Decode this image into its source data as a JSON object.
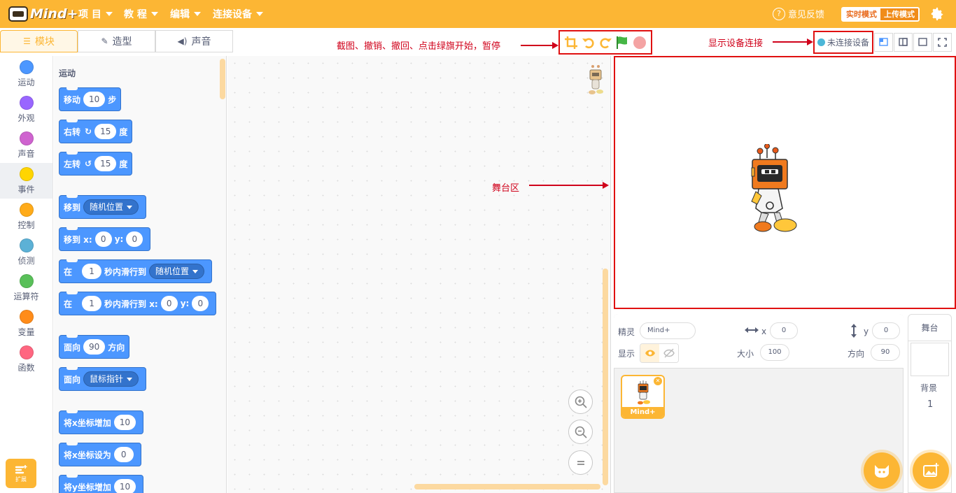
{
  "app": {
    "logo_text": "Mind+",
    "menu": [
      {
        "label": "项 目"
      },
      {
        "label": "教 程"
      },
      {
        "label": "编辑"
      },
      {
        "label": "连接设备"
      }
    ],
    "feedback": "意见反馈",
    "mode_realtime": "实时模式",
    "mode_upload": "上传模式",
    "accent_color": "#fcb634"
  },
  "tabs": [
    {
      "label": "模块",
      "icon": "blocks-icon"
    },
    {
      "label": "造型",
      "icon": "brush-icon"
    },
    {
      "label": "声音",
      "icon": "speaker-icon"
    }
  ],
  "annotations": {
    "toolbar": "截图、撤销、撤回、点击绿旗开始，暂停",
    "device": "显示设备连接",
    "stage": "舞台区"
  },
  "device_status": "未连接设备",
  "categories": [
    {
      "label": "运动",
      "color": "#4c97ff"
    },
    {
      "label": "外观",
      "color": "#9966ff"
    },
    {
      "label": "声音",
      "color": "#cf63cf"
    },
    {
      "label": "事件",
      "color": "#ffd500"
    },
    {
      "label": "控制",
      "color": "#ffab19"
    },
    {
      "label": "侦测",
      "color": "#5cb1d6"
    },
    {
      "label": "运算符",
      "color": "#59c059"
    },
    {
      "label": "变量",
      "color": "#ff8c1a"
    },
    {
      "label": "函数",
      "color": "#ff6680"
    }
  ],
  "extension_label": "扩展",
  "palette": {
    "section_title": "运动",
    "blocks": {
      "move": {
        "a": "移动",
        "v": "10",
        "b": "步"
      },
      "turn_right": {
        "a": "右转",
        "icon": "↻",
        "v": "15",
        "b": "度"
      },
      "turn_left": {
        "a": "左转",
        "icon": "↺",
        "v": "15",
        "b": "度"
      },
      "goto": {
        "a": "移到",
        "d": "随机位置"
      },
      "goto_xy": {
        "a": "移到 x:",
        "x": "0",
        "y_label": "y:",
        "y": "0"
      },
      "glide": {
        "a": "在",
        "v": "1",
        "b": "秒内滑行到",
        "d": "随机位置"
      },
      "glide_xy": {
        "a": "在",
        "v": "1",
        "b": "秒内滑行到 x:",
        "x": "0",
        "y_label": "y:",
        "y": "0"
      },
      "point_dir": {
        "a": "面向",
        "v": "90",
        "b": "方向"
      },
      "point_towards": {
        "a": "面向",
        "d": "鼠标指针"
      },
      "change_x": {
        "a": "将x坐标增加",
        "v": "10"
      },
      "set_x": {
        "a": "将x坐标设为",
        "v": "0"
      },
      "change_y": {
        "a": "将y坐标增加",
        "v": "10"
      }
    }
  },
  "sprite_info": {
    "sprite_label": "精灵",
    "sprite_name": "Mind+",
    "x_label": "x",
    "x": "0",
    "y_label": "y",
    "y": "0",
    "show_label": "显示",
    "size_label": "大小",
    "size": "100",
    "direction_label": "方向",
    "direction": "90"
  },
  "sprite_thumb_name": "Mind+",
  "stage_col": {
    "header": "舞台",
    "backdrop_label": "背景",
    "backdrop_count": "1"
  }
}
